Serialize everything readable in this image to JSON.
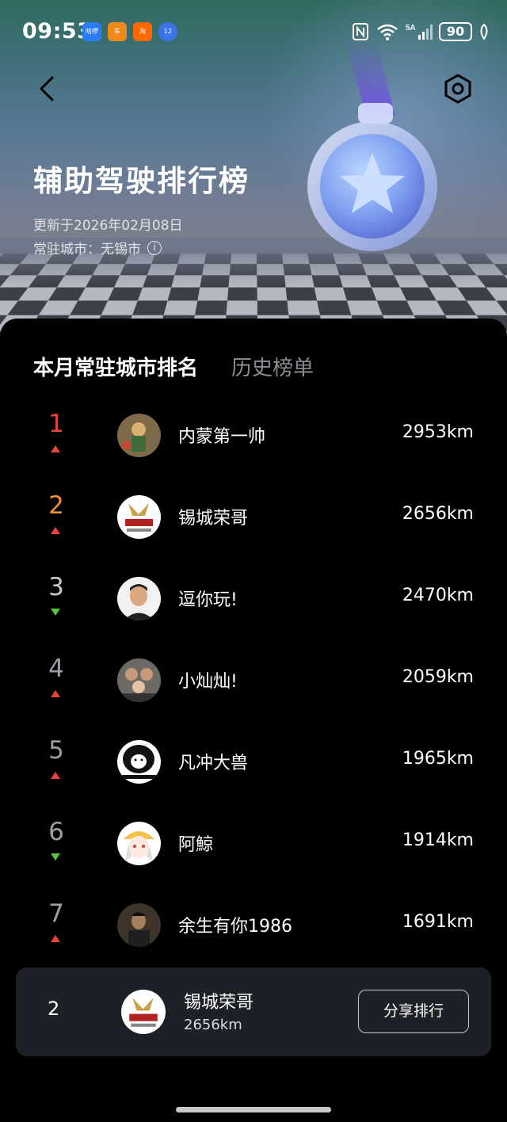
{
  "status_bar": {
    "time": "09:53",
    "battery": "90",
    "network": "5A",
    "app_icons": [
      {
        "name": "hello-app-icon",
        "label": "哈啰",
        "color": "#2c7cf6"
      },
      {
        "name": "news-app-icon",
        "label": "车",
        "color": "#f08a1b"
      },
      {
        "name": "taobao-app-icon",
        "label": "淘",
        "color": "#ff6a00"
      },
      {
        "name": "finance-app-icon",
        "label": "12",
        "color": "#3a74e8"
      }
    ]
  },
  "header": {
    "title": "辅助驾驶排行榜",
    "update_text": "更新于2026年02月08日",
    "city_label": "常驻城市：无锡市"
  },
  "tabs": [
    {
      "label": "本月常驻城市排名",
      "active": true
    },
    {
      "label": "历史榜单",
      "active": false
    }
  ],
  "rankings": [
    {
      "rank": "1",
      "name": "内蒙第一帅",
      "distance": "2953km",
      "trend": "up",
      "rank_color": "#e6453b",
      "avatar_color": "#6a5a3a"
    },
    {
      "rank": "2",
      "name": "锡城荣哥",
      "distance": "2656km",
      "trend": "up",
      "rank_color": "#f0913a",
      "avatar_color": "#ffffff"
    },
    {
      "rank": "3",
      "name": "逗你玩!",
      "distance": "2470km",
      "trend": "down",
      "rank_color": "#c8cad0",
      "avatar_color": "#f2f2f2"
    },
    {
      "rank": "4",
      "name": "小灿灿!",
      "distance": "2059km",
      "trend": "up",
      "rank_color": "#9c9ea3",
      "avatar_color": "#5a5a5a"
    },
    {
      "rank": "5",
      "name": "凡冲大兽",
      "distance": "1965km",
      "trend": "up",
      "rank_color": "#9c9ea3",
      "avatar_color": "#ffffff"
    },
    {
      "rank": "6",
      "name": "阿鯨",
      "distance": "1914km",
      "trend": "down",
      "rank_color": "#9c9ea3",
      "avatar_color": "#f4c14a"
    },
    {
      "rank": "7",
      "name": "余生有你1986",
      "distance": "1691km",
      "trend": "up",
      "rank_color": "#9c9ea3",
      "avatar_color": "#4a4030"
    }
  ],
  "my_rank": {
    "rank": "2",
    "name": "锡城荣哥",
    "distance": "2656km",
    "share_label": "分享排行"
  }
}
